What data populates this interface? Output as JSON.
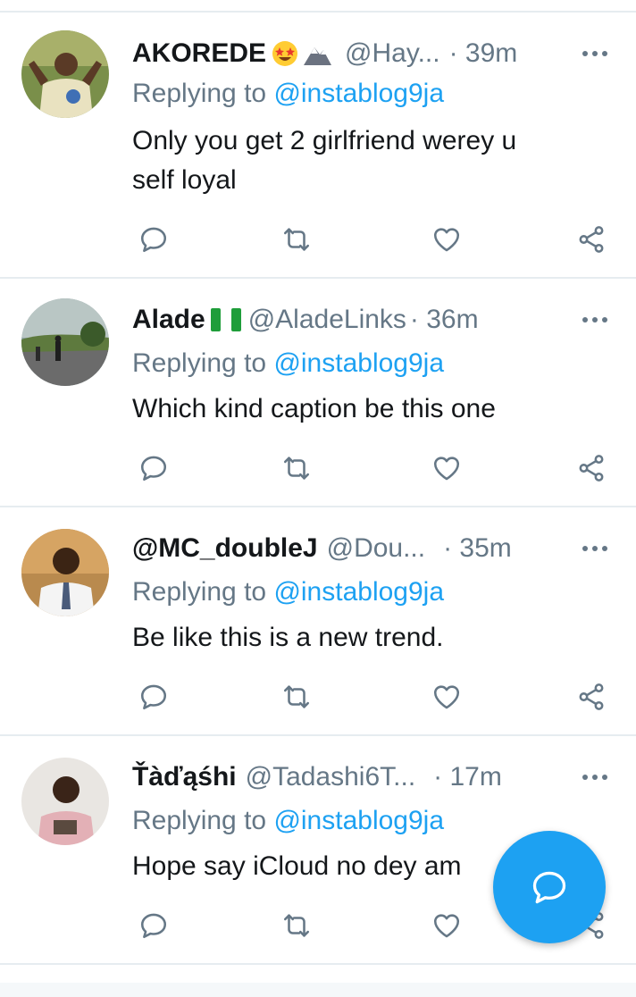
{
  "mention_prefix": "Replying to",
  "colors": {
    "accent": "#1da1f2",
    "secondary_text": "#657786",
    "primary_text": "#14171a",
    "divider": "#e6ecf0"
  },
  "tweets": [
    {
      "name": "AKOREDE",
      "badges": [
        "star-struck-emoji-icon",
        "eagle-mountain-emoji-icon"
      ],
      "handle": "@Hay...",
      "time": "· 39m",
      "replying_to": "@instablog9ja",
      "text_lines": [
        "Only you get 2 girlfriend werey u",
        "self loyal"
      ]
    },
    {
      "name": "Alade",
      "badges": [
        "nigeria-flag-icon"
      ],
      "handle": "@AladeLinks",
      "time": "· 36m",
      "replying_to": "@instablog9ja",
      "text_lines": [
        "Which kind caption be this one"
      ]
    },
    {
      "name": "@MC_doubleJ",
      "badges": [],
      "handle": "@Dou...",
      "time": "· 35m",
      "replying_to": "@instablog9ja",
      "text_lines": [
        "Be like this is a new trend."
      ]
    },
    {
      "name": "Ťàďąśhi",
      "badges": [],
      "handle": "@Tadashi6T...",
      "time": "· 17m",
      "replying_to": "@instablog9ja",
      "text_lines": [
        "Hope say iCloud no dey am"
      ]
    }
  ],
  "fab_icon": "compose-reply-icon"
}
